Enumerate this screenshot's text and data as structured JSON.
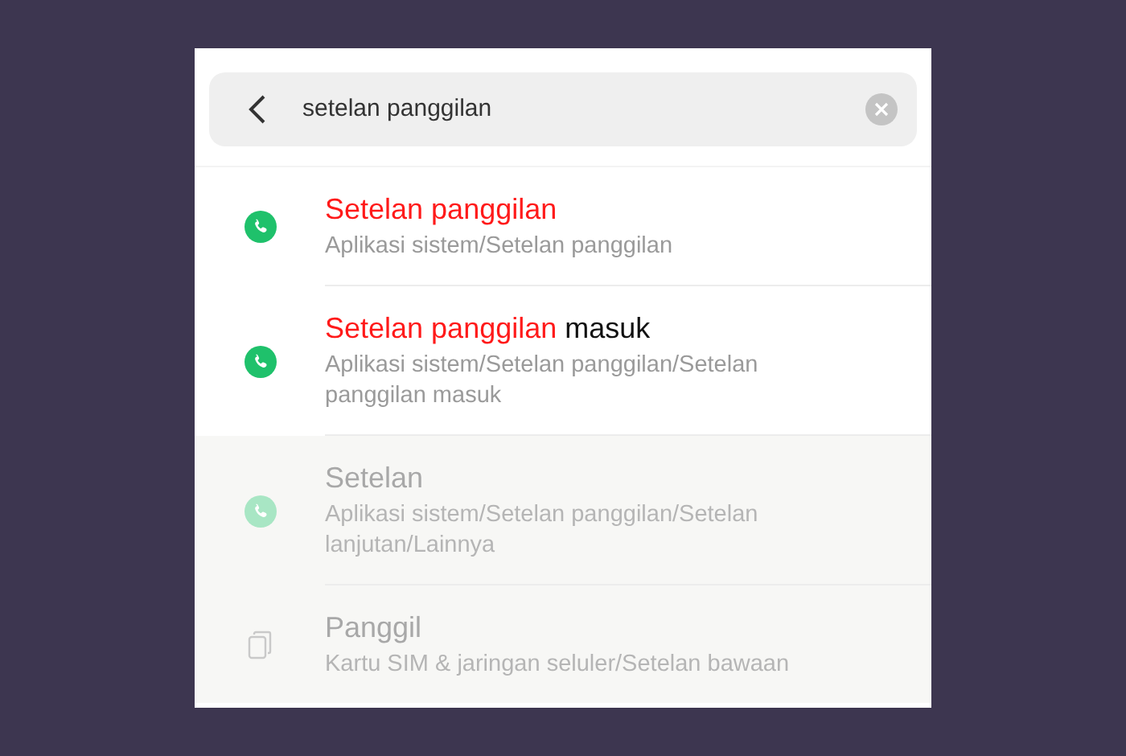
{
  "search": {
    "value": "setelan panggilan"
  },
  "results": [
    {
      "kind": "phone",
      "disabled": false,
      "title": [
        {
          "text": "Setelan panggilan",
          "matched": true
        }
      ],
      "path": "Aplikasi sistem/Setelan panggilan"
    },
    {
      "kind": "phone",
      "disabled": false,
      "title": [
        {
          "text": "Setelan panggilan",
          "matched": true
        },
        {
          "text": "masuk",
          "matched": false
        }
      ],
      "path": "Aplikasi sistem/Setelan panggilan/Setelan panggilan masuk"
    },
    {
      "kind": "phone",
      "disabled": true,
      "title": [
        {
          "text": "Setelan",
          "matched": false
        }
      ],
      "path": "Aplikasi sistem/Setelan panggilan/Setelan lanjutan/Lainnya"
    },
    {
      "kind": "sim",
      "disabled": true,
      "title": [
        {
          "text": "Panggil",
          "matched": false
        }
      ],
      "path": "Kartu SIM & jaringan seluler/Setelan bawaan"
    }
  ]
}
